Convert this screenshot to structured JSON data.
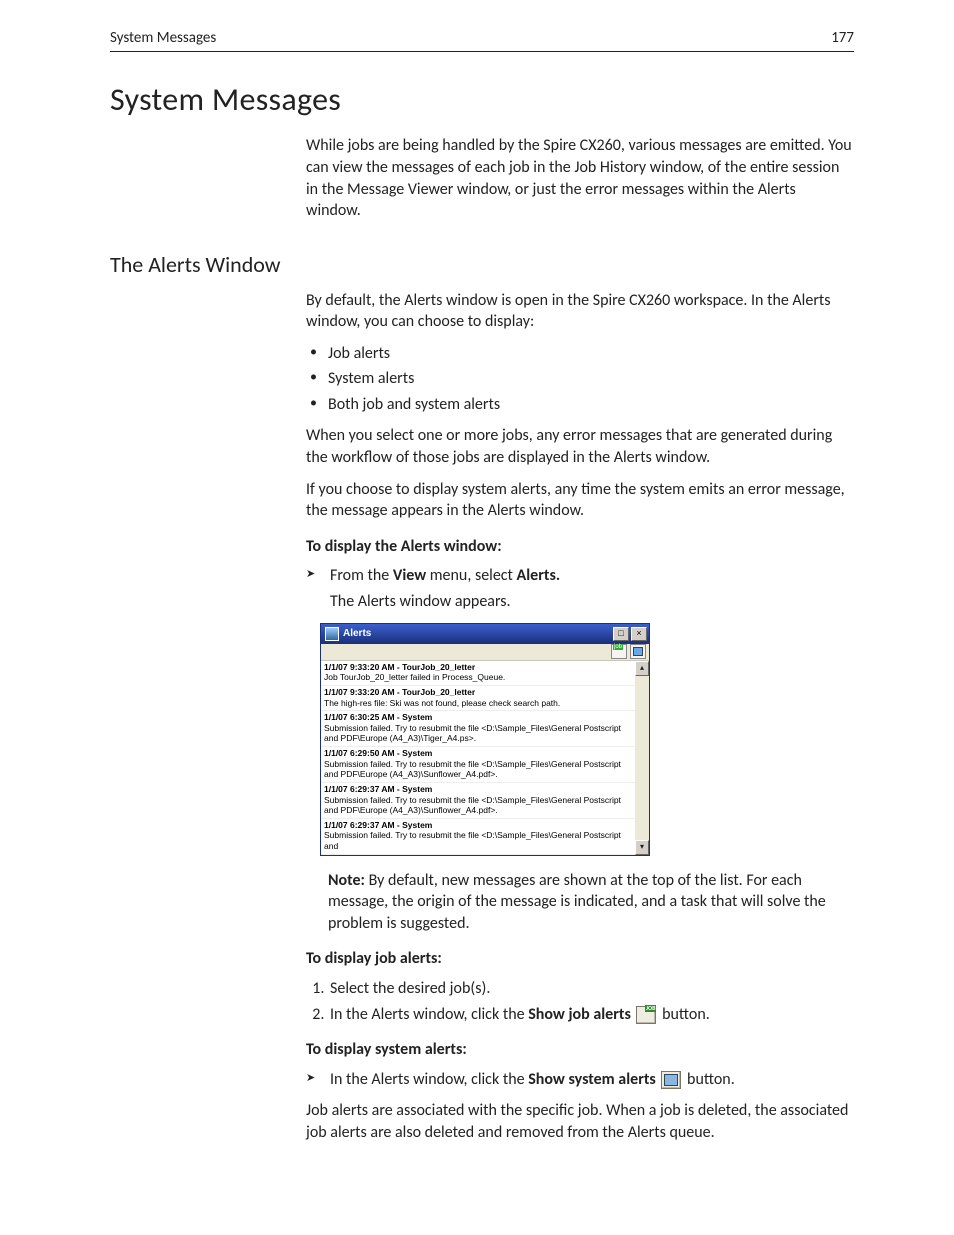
{
  "header": {
    "running_head": "System Messages",
    "page_number": "177"
  },
  "title": "System Messages",
  "intro": "While jobs are being handled by the Spire CX260, various messages are emitted. You can view the messages of each job in the Job History window, of the entire session in the Message Viewer window, or just the error messages within the Alerts window.",
  "section": {
    "heading": "The Alerts Window",
    "p1": "By default, the Alerts window is open in the Spire CX260 workspace. In the Alerts window, you can choose to display:",
    "bullets": {
      "b1": "Job alerts",
      "b2": "System alerts",
      "b3": "Both job and system alerts"
    },
    "p2": "When you select one or more jobs, any error messages that are generated during the workflow of those jobs are displayed in the Alerts window.",
    "p3": "If you choose to display system alerts, any time the system emits an error message, the message appears in the Alerts window.",
    "lead1": "To display the Alerts window:",
    "step1a": "From the ",
    "step1_menu": "View",
    "step1b": " menu, select ",
    "step1_item": "Alerts.",
    "result1": "The Alerts window appears.",
    "note_label": "Note:",
    "note_body": "  By default, new messages are shown at the top of the list. For each message, the origin of the message is indicated, and a task that will solve the problem is suggested.",
    "lead2": "To display job alerts:",
    "step2_1": "Select the desired job(s).",
    "step2_2a": "In the Alerts window, click the ",
    "step2_2b": "Show job alerts",
    "step2_2c": " button.",
    "lead3": "To display system alerts:",
    "step3_a": "In the Alerts window, click the ",
    "step3_b": "Show system alerts",
    "step3_c": " button.",
    "p_final": "Job alerts are associated with the specific job. When a job is deleted, the associated job alerts are also deleted and removed from the Alerts queue."
  },
  "alerts_window": {
    "title": "Alerts",
    "toolbar": {
      "icon1": "job-alerts-icon",
      "icon2": "system-alerts-icon"
    },
    "entries": [
      {
        "hdr": "1/1/07 9:33:20 AM - TourJob_20_letter",
        "body": "Job TourJob_20_letter failed in Process_Queue."
      },
      {
        "hdr": "1/1/07 9:33:20 AM - TourJob_20_letter",
        "body": "The high-res file: Ski was not found, please check search path."
      },
      {
        "hdr": "1/1/07 6:30:25 AM - System",
        "body": "Submission failed. Try to resubmit the file <D:\\Sample_Files\\General Postscript and PDF\\Europe (A4_A3)\\Tiger_A4.ps>."
      },
      {
        "hdr": "1/1/07 6:29:50 AM - System",
        "body": "Submission failed. Try to resubmit the file <D:\\Sample_Files\\General Postscript and PDF\\Europe (A4_A3)\\Sunflower_A4.pdf>."
      },
      {
        "hdr": "1/1/07 6:29:37 AM - System",
        "body": "Submission failed. Try to resubmit the file <D:\\Sample_Files\\General Postscript and PDF\\Europe (A4_A3)\\Sunflower_A4.pdf>."
      },
      {
        "hdr": "1/1/07 6:29:37 AM - System",
        "body": "Submission failed. Try to resubmit the file <D:\\Sample_Files\\General Postscript and"
      }
    ]
  }
}
